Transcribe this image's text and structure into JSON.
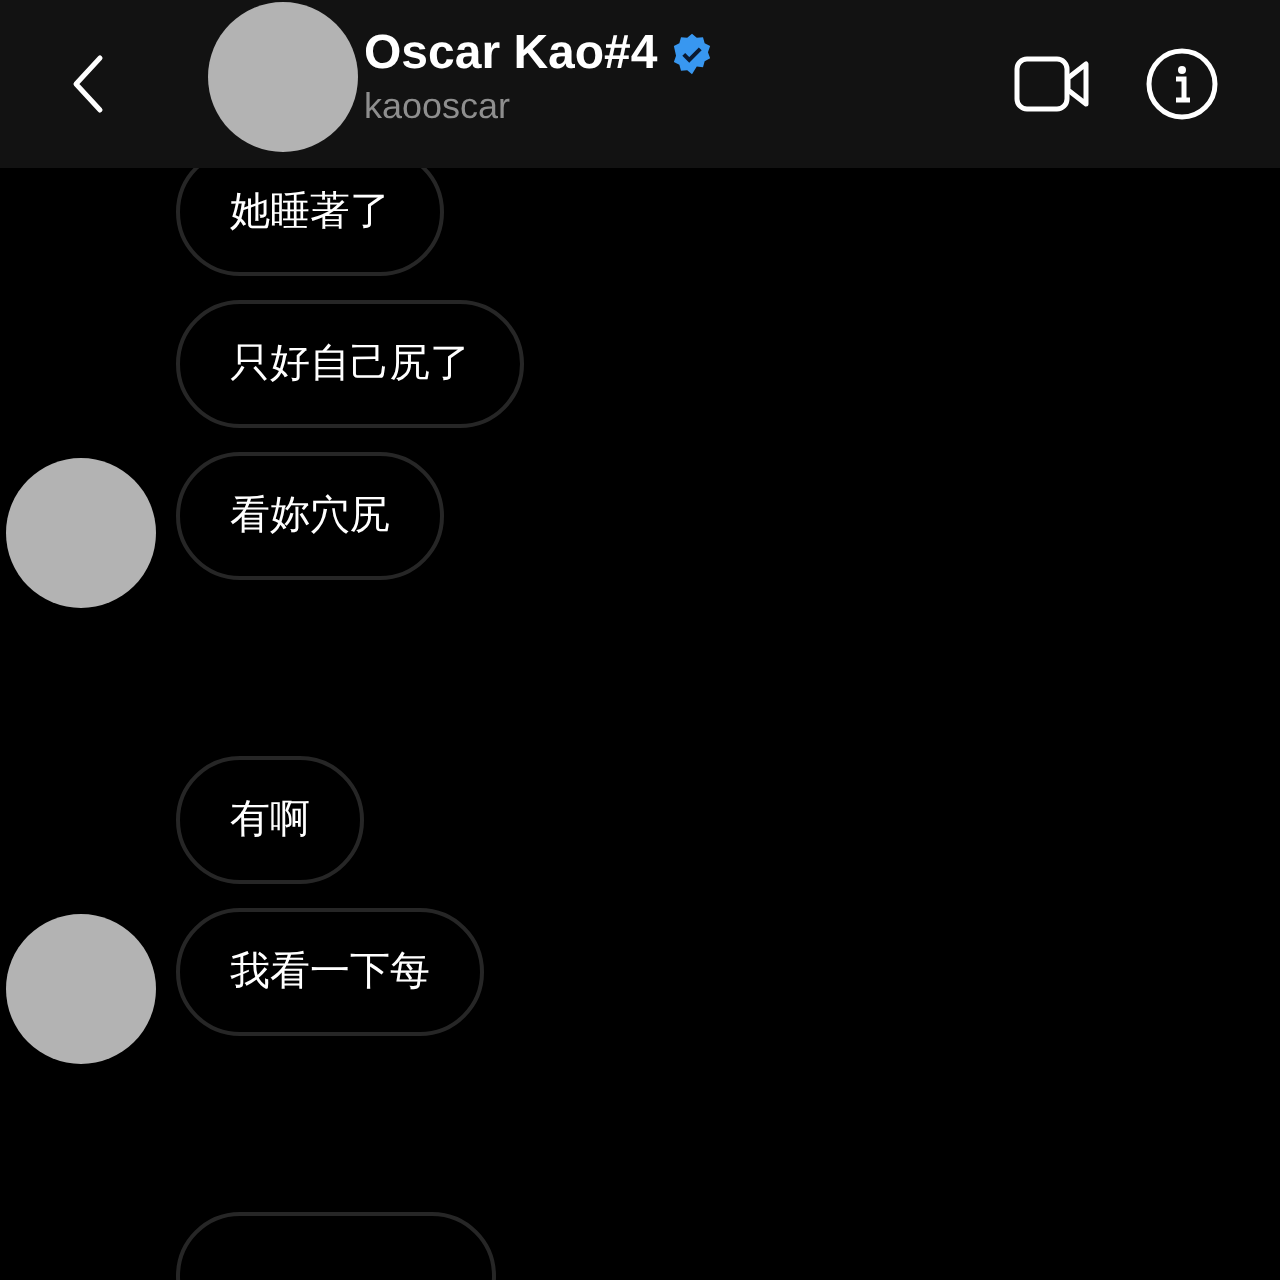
{
  "header": {
    "name": "Oscar Kao#4",
    "verified": true,
    "username": "kaooscar"
  },
  "groups": [
    {
      "avatar": true,
      "messages": [
        {
          "kind": "text",
          "text": "她睡著了"
        },
        {
          "kind": "text",
          "text": "只好自己尻了"
        },
        {
          "kind": "text",
          "text": "看妳穴尻"
        }
      ]
    },
    {
      "avatar": true,
      "messages": [
        {
          "kind": "text",
          "text": "有啊"
        },
        {
          "kind": "text",
          "text": "我看一下每"
        }
      ]
    },
    {
      "avatar": false,
      "messages": [
        {
          "kind": "cut"
        }
      ]
    }
  ]
}
